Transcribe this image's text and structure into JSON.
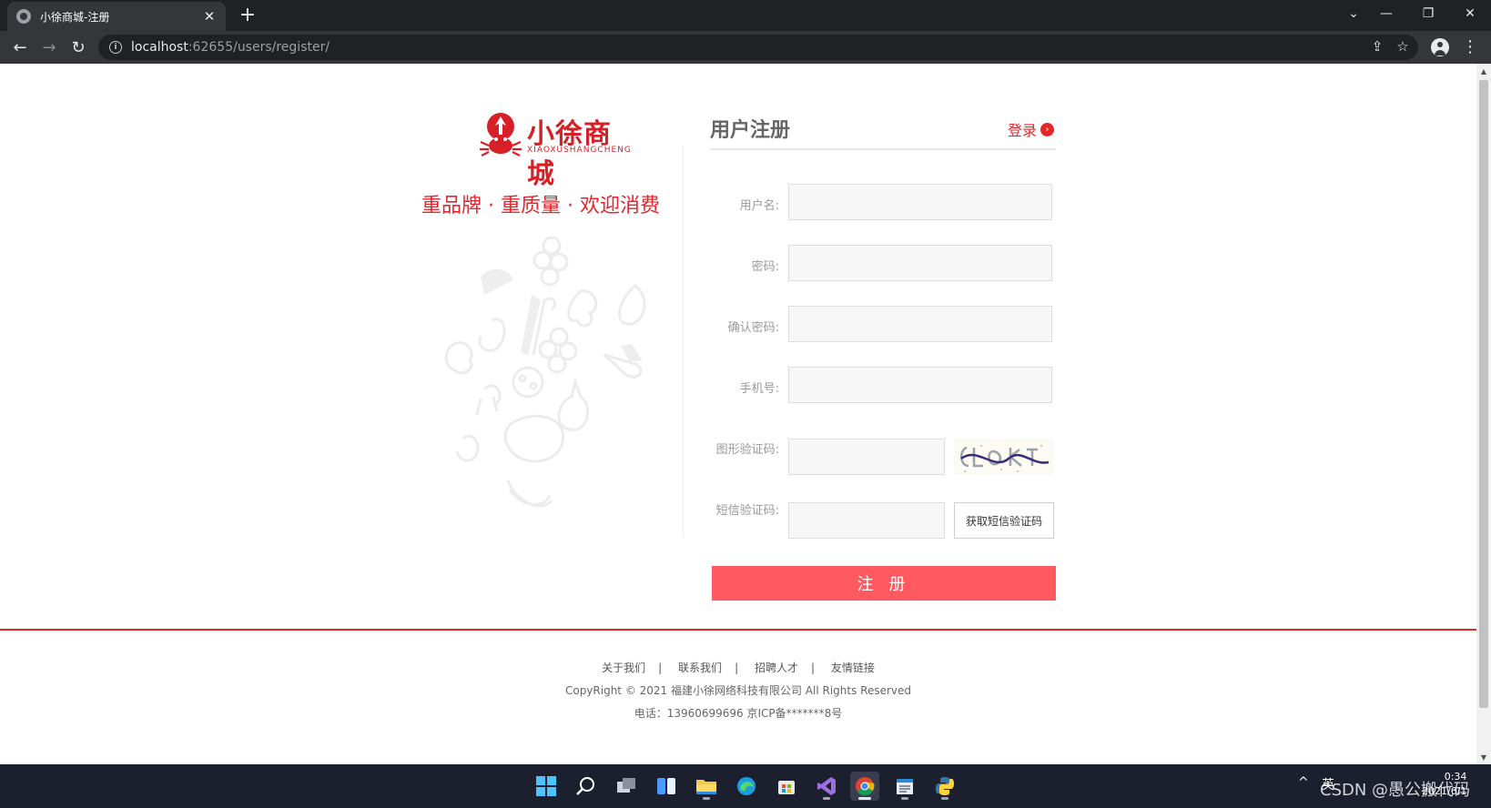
{
  "browser": {
    "tab_title": "小徐商城-注册",
    "tab_close": "✕",
    "new_tab": "+",
    "url_host": "localhost",
    "url_rest": ":62655/users/register/",
    "nav_back": "←",
    "nav_forward": "→",
    "nav_reload": "↻",
    "info_glyph": "i",
    "share_glyph": "⇪",
    "star_glyph": "☆",
    "menu_glyph": "⋮",
    "window_controls": {
      "tablist": "⌄",
      "minimize": "—",
      "restore": "❐",
      "close": "✕"
    }
  },
  "brand": {
    "name": "小徐商城",
    "pinyin": "XIAOXUSHANGCHENG",
    "slogan": "重品牌 · 重质量 · 欢迎消费",
    "color": "#d61f26"
  },
  "register": {
    "title": "用户注册",
    "login_link": "登录",
    "login_arrow": "›",
    "fields": [
      {
        "label": "用户名:"
      },
      {
        "label": "密码:"
      },
      {
        "label": "确认密码:"
      },
      {
        "label": "手机号:"
      },
      {
        "label": "图形验证码:"
      },
      {
        "label": "短信验证码:"
      }
    ],
    "sms_button": "获取短信验证码",
    "submit_button": "注 册",
    "accent": "#ff5a5f"
  },
  "footer": {
    "links": [
      "关于我们",
      "联系我们",
      "招聘人才",
      "友情链接"
    ],
    "separator": "|",
    "copyright": "CopyRight © 2021 福建小徐网络科技有限公司 All Rights Reserved",
    "contact": "电话：13960699696 京ICP备*******8号"
  },
  "taskbar": {
    "icons": [
      "windows-start-icon",
      "search-icon",
      "task-view-icon",
      "widgets-icon",
      "file-explorer-icon",
      "edge-icon",
      "store-icon",
      "visual-studio-icon",
      "chrome-icon",
      "notepad-icon",
      "python-icon"
    ],
    "tray_caret": "^",
    "tray_lang": "英",
    "time": "0:34",
    "date": "2021/6/1",
    "watermark": "CSDN @愚公搬代码"
  }
}
